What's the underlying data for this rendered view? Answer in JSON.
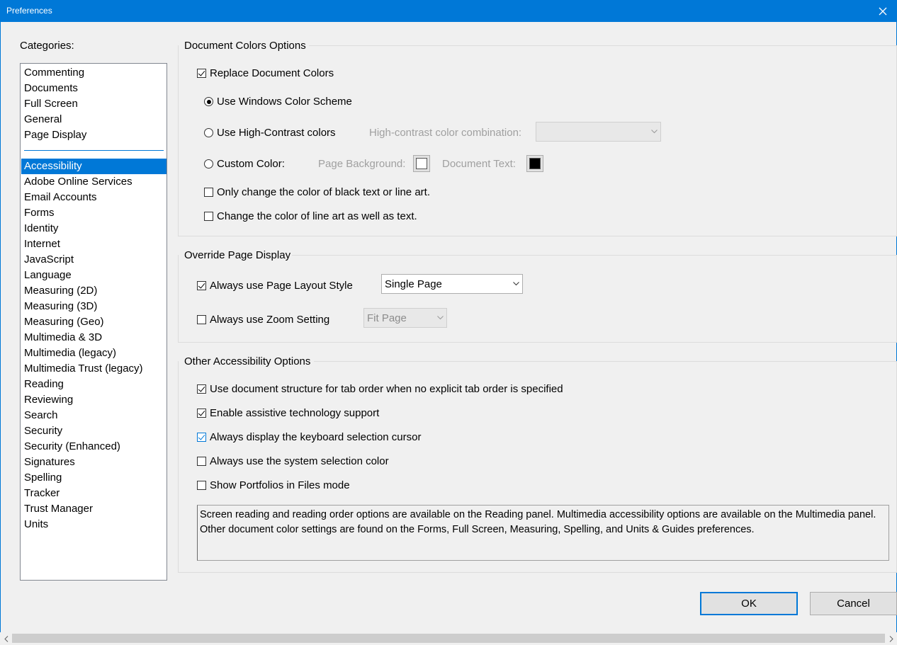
{
  "window": {
    "title": "Preferences"
  },
  "categories": {
    "label": "Categories:",
    "top_items": [
      "Commenting",
      "Documents",
      "Full Screen",
      "General",
      "Page Display"
    ],
    "items": [
      "Accessibility",
      "Adobe Online Services",
      "Email Accounts",
      "Forms",
      "Identity",
      "Internet",
      "JavaScript",
      "Language",
      "Measuring (2D)",
      "Measuring (3D)",
      "Measuring (Geo)",
      "Multimedia & 3D",
      "Multimedia (legacy)",
      "Multimedia Trust (legacy)",
      "Reading",
      "Reviewing",
      "Search",
      "Security",
      "Security (Enhanced)",
      "Signatures",
      "Spelling",
      "Tracker",
      "Trust Manager",
      "Units"
    ],
    "selected": "Accessibility"
  },
  "doc_colors": {
    "title": "Document Colors Options",
    "replace_label": "Replace Document Colors",
    "replace_checked": true,
    "windows_scheme_label": "Use Windows Color Scheme",
    "high_contrast_label": "Use High-Contrast colors",
    "hc_combination_label": "High-contrast color combination:",
    "hc_combination_value": "",
    "custom_color_label": "Custom Color:",
    "page_bg_label": "Page Background:",
    "doc_text_label": "Document Text:",
    "page_bg_color": "#ffffff",
    "doc_text_color": "#000000",
    "only_black_label": "Only change the color of black text or line art.",
    "line_art_label": "Change the color of line art as well as text.",
    "selected_scheme": "windows"
  },
  "override": {
    "title": "Override Page Display",
    "layout_label": "Always use Page Layout Style",
    "layout_checked": true,
    "layout_value": "Single Page",
    "zoom_label": "Always use Zoom Setting",
    "zoom_checked": false,
    "zoom_value": "Fit Page"
  },
  "other": {
    "title": "Other Accessibility Options",
    "options": [
      {
        "label": "Use document structure for tab order when no explicit tab order is specified",
        "checked": true
      },
      {
        "label": "Enable assistive technology support",
        "checked": true
      },
      {
        "label": "Always display the keyboard selection cursor",
        "checked": true
      },
      {
        "label": "Always use the system selection color",
        "checked": false
      },
      {
        "label": "Show Portfolios in Files mode",
        "checked": false
      }
    ],
    "info_text": "Screen reading and reading order options are available on the Reading panel. Multimedia accessibility options are available on the Multimedia panel. Other document color settings are found on the Forms, Full Screen, Measuring, Spelling, and Units & Guides preferences."
  },
  "buttons": {
    "ok": "OK",
    "cancel": "Cancel"
  },
  "colors": {
    "accent": "#0078d7",
    "window_bg": "#f0f0f0"
  }
}
